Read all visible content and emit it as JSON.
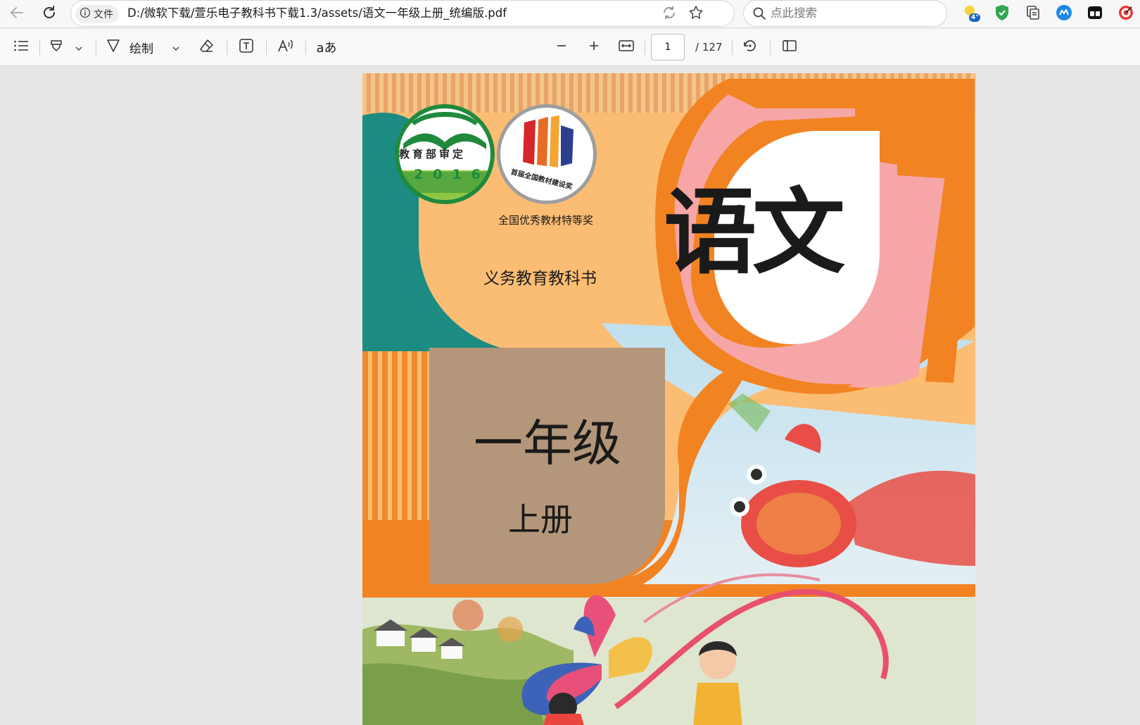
{
  "browser": {
    "url_badge": "文件",
    "url": "D:/微软下载/萱乐电子教科书下载1.3/assets/语文一年级上册_统编版.pdf",
    "search_placeholder": "点此搜索",
    "weather_temp": "4°",
    "icons": [
      "back-arrow-icon",
      "reload-icon",
      "info-icon",
      "sync-icon",
      "star-icon",
      "search-icon",
      "weather-icon",
      "shield-icon",
      "collections-icon",
      "extension-icon",
      "split-screen-icon",
      "target-icon"
    ]
  },
  "pdf_toolbar": {
    "draw_label": "绘制",
    "translate_label": "aあ",
    "page_current": "1",
    "page_total": "/ 127",
    "icons": [
      "contents-icon",
      "highlight-icon",
      "chevron-down-icon",
      "draw-icon",
      "eraser-icon",
      "text-box-icon",
      "read-aloud-icon",
      "zoom-out-icon",
      "zoom-in-icon",
      "fit-width-icon",
      "rotate-icon",
      "page-view-icon"
    ]
  },
  "cover": {
    "seal_text": "教育部审定",
    "seal_year": "2016",
    "award_ring_text": "首届全国教材建设奖",
    "award_caption": "全国优秀教材特等奖",
    "series": "义务教育教科书",
    "title": "语文",
    "grade": "一年级",
    "volume": "上册",
    "colors": {
      "orange": "#f28322",
      "peach": "#fbbd74",
      "teal": "#1c8c83",
      "pink": "#f6a6a6",
      "brown": "#b4967a",
      "sky": "#cfe4ef",
      "green_seal": "#1f8a3c"
    }
  }
}
